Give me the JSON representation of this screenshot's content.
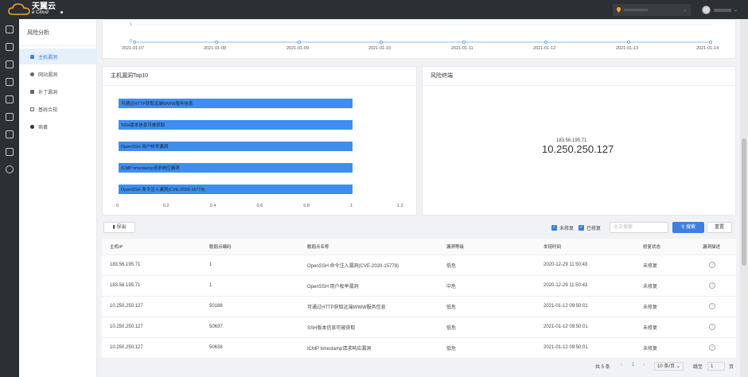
{
  "brand": {
    "name": "天翼云",
    "sub": "e Cloud"
  },
  "sidebar": {
    "title": "风险分析",
    "items": [
      {
        "label": "主机漏洞",
        "active": true
      },
      {
        "label": "网站漏洞"
      },
      {
        "label": "补丁漏洞"
      },
      {
        "label": "基线合规"
      },
      {
        "label": "病毒"
      }
    ]
  },
  "trend": {
    "y_ticks": [
      "1",
      "0"
    ],
    "x_ticks": [
      "2021-01-07",
      "2021-01-08",
      "2021-01-09",
      "2021-01-10",
      "2021-01-11",
      "2021-01-12",
      "2021-01-13",
      "2021-01-14"
    ]
  },
  "top10": {
    "title": "主机漏洞Top10",
    "chart_data": {
      "type": "bar",
      "orientation": "horizontal",
      "categories": [
        "可通过HTTP获取远端WWW服务信息",
        "SSH版本信息可被获取",
        "OpenSSH 用户枚举漏洞",
        "ICMP timestamp请求响应漏洞",
        "OpenSSH 命令注入漏洞(CVE-2020-15778)"
      ],
      "values": [
        1,
        1,
        1,
        1,
        1
      ],
      "xlim": [
        0,
        1.2
      ],
      "x_ticks": [
        "0",
        "0.2",
        "0.4",
        "0.6",
        "0.8",
        "1",
        "1.2"
      ],
      "color": "#3d8ef0"
    }
  },
  "risk": {
    "title": "风险终端",
    "small_ip": "183.56.195.71",
    "big_ip": "10.250.250.127"
  },
  "toolbar": {
    "export": "导出",
    "unfixed": "未修复",
    "fixed": "已修复",
    "search_placeholder": "全文搜索",
    "search": "搜索",
    "reset": "重置"
  },
  "table": {
    "headers": [
      "主机IP",
      "脆弱点编码",
      "脆弱点名称",
      "漏洞等级",
      "发现时间",
      "修复状态",
      "漏洞描述"
    ],
    "rows": [
      [
        "183.56.195.71",
        "1",
        "OpenSSH 命令注入漏洞(CVE-2020-15778)",
        "低危",
        "2020-12-29 11:50:43",
        "未修复"
      ],
      [
        "183.56.195.71",
        "1",
        "OpenSSH 用户枚举漏洞",
        "中危",
        "2020-12-29 11:50:43",
        "未修复"
      ],
      [
        "10.250.250.127",
        "50188",
        "可通过HTTP获取远端WWW服务信息",
        "低危",
        "2021-01-12 09:50:01",
        "未修复"
      ],
      [
        "10.250.250.127",
        "50637",
        "SSH版本信息可被获取",
        "低危",
        "2021-01-12 09:50:01",
        "未修复"
      ],
      [
        "10.250.250.127",
        "50638",
        "ICMP timestamp请求响应漏洞",
        "低危",
        "2021-01-12 09:50:01",
        "未修复"
      ]
    ]
  },
  "pager": {
    "total": "共 5 条",
    "page": "1",
    "size": "10 条/页",
    "goto": "跳至",
    "goto_val": "1",
    "page_unit": "页"
  }
}
